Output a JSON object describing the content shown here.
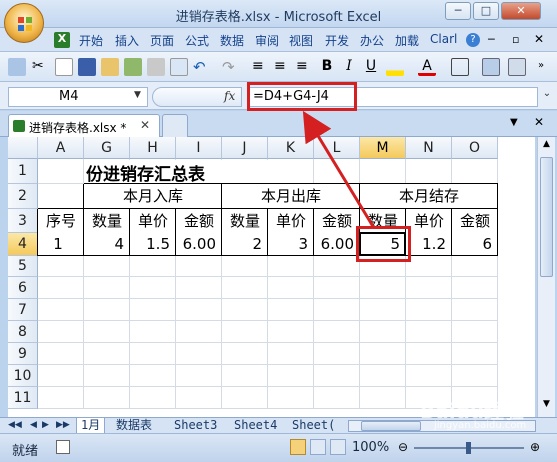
{
  "window": {
    "title": "进销存表格.xlsx - Microsoft Excel",
    "min": "─",
    "max": "□",
    "close": "✕"
  },
  "ribbon": {
    "tabs": [
      "开始",
      "插入",
      "页面",
      "公式",
      "数据",
      "审阅",
      "视图",
      "开发",
      "办公",
      "加载",
      "Clarl"
    ]
  },
  "formula_bar": {
    "name_box": "M4",
    "fx": "fx",
    "formula": "=D4+G4-J4"
  },
  "doc_tab": {
    "name": "进销存表格.xlsx *",
    "close": "✕"
  },
  "columns": [
    "A",
    "G",
    "H",
    "I",
    "J",
    "K",
    "L",
    "M",
    "N",
    "O"
  ],
  "selected_column": "M",
  "rows": [
    "1",
    "2",
    "3",
    "4",
    "5",
    "6",
    "7",
    "8",
    "9",
    "10",
    "11"
  ],
  "selected_row": "4",
  "sheet": {
    "title": "份进销存汇总表",
    "group_in": "本月入库",
    "group_out": "本月出库",
    "group_stock": "本月结存",
    "seq_header": "序号",
    "sub_headers": [
      "数量",
      "单价",
      "金额",
      "数量",
      "单价",
      "金额",
      "数量",
      "单价",
      "金额"
    ],
    "row4": [
      "1",
      "4",
      "1.5",
      "6.00",
      "2",
      "3",
      "6.00",
      "5",
      "1.2",
      "6"
    ]
  },
  "sheet_tabs": [
    "1月",
    "数据表",
    "Sheet3",
    "Sheet4",
    "Sheet("
  ],
  "status": {
    "ready": "就绪",
    "zoom": "100%"
  },
  "watermark": {
    "text": "Baidu经验",
    "sub": "jingyan.baidu.com"
  }
}
